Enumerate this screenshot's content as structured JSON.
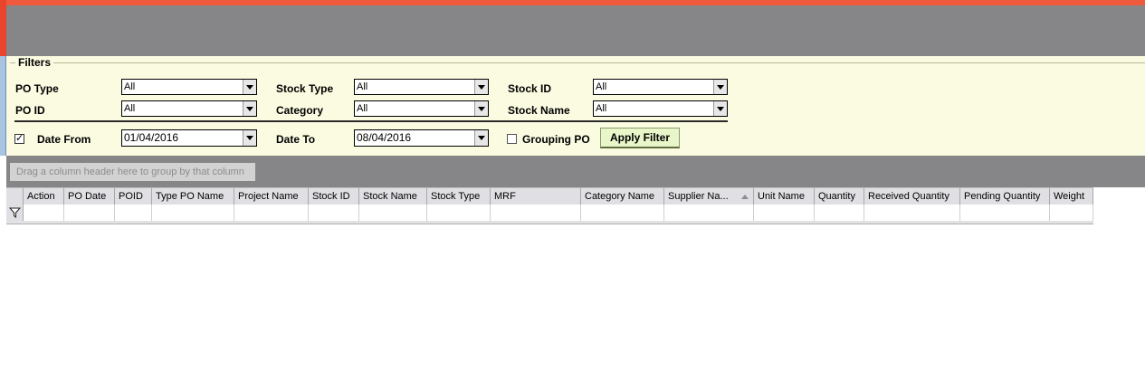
{
  "filters": {
    "title": "Filters",
    "po_type": {
      "label": "PO Type",
      "value": "All"
    },
    "stock_type": {
      "label": "Stock Type",
      "value": "All"
    },
    "stock_id": {
      "label": "Stock ID",
      "value": "All"
    },
    "po_id": {
      "label": "PO ID",
      "value": "All"
    },
    "category": {
      "label": "Category",
      "value": "All"
    },
    "stock_name": {
      "label": "Stock Name",
      "value": "All"
    },
    "date_from": {
      "label": "Date From",
      "value": "01/04/2016",
      "checked": true,
      "check_glyph": "✓"
    },
    "date_to": {
      "label": "Date To",
      "value": "08/04/2016"
    },
    "grouping_po": {
      "label": "Grouping PO",
      "checked": false
    },
    "apply_label": "Apply Filter"
  },
  "grid": {
    "group_panel_text": "Drag a column header here to group by that column",
    "columns": [
      "Action",
      "PO Date",
      "POID",
      "Type PO Name",
      "Project Name",
      "Stock ID",
      "Stock Name",
      "Stock Type",
      "MRF",
      "Category Name",
      "Supplier Na...",
      "Unit Name",
      "Quantity",
      "Received Quantity",
      "Pending Quantity",
      "Weight"
    ],
    "sorted_column": "Supplier Na...",
    "filter_icon": "filter-funnel-icon"
  },
  "colors": {
    "accent_red": "#f05a3c",
    "title_bar": "#868587",
    "filter_bg": "#fbfbe2",
    "apply_button": "#e9f6c9"
  }
}
